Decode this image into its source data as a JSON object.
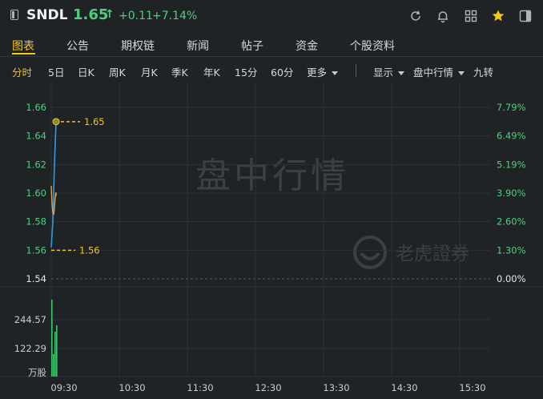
{
  "header": {
    "symbol": "SNDL",
    "price": "1.65",
    "price_arrow": "↑",
    "change": "+0.11",
    "change_pct": "+7.14%"
  },
  "tabs": [
    "图表",
    "公告",
    "期权链",
    "新闻",
    "帖子",
    "资金",
    "个股资料"
  ],
  "active_tab": "图表",
  "periods": [
    "分时",
    "5日",
    "日K",
    "周K",
    "月K",
    "季K",
    "年K",
    "15分",
    "60分",
    "更多"
  ],
  "active_period": "分时",
  "toolbar_right": [
    "显示",
    "盘中行情",
    "九转"
  ],
  "chart": {
    "watermark": "盘中行情",
    "brand": "老虎證券",
    "left_ticks": [
      "1.66",
      "1.64",
      "1.62",
      "1.60",
      "1.58",
      "1.56",
      "1.54"
    ],
    "right_ticks": [
      "7.79%",
      "6.49%",
      "5.19%",
      "3.90%",
      "2.60%",
      "1.30%",
      "0.00%"
    ],
    "high_label": "1.65",
    "low_label": "1.56",
    "volume_ticks": [
      "244.57",
      "122.29"
    ],
    "volume_unit": "万股",
    "time_labels": [
      "09:30",
      "10:30",
      "11:30",
      "12:30",
      "13:30",
      "14:30",
      "15:30"
    ]
  },
  "colors": {
    "up": "#4cd07d",
    "accent": "#f5c518",
    "price_line": "#2e9be6",
    "avg_line": "#e8a050",
    "volume": "#3fc46c"
  },
  "chart_data": {
    "type": "line",
    "x_axis": [
      "09:30",
      "10:30",
      "11:30",
      "12:30",
      "13:30",
      "14:30",
      "15:30"
    ],
    "y_axis_left": [
      1.54,
      1.56,
      1.58,
      1.6,
      1.62,
      1.64,
      1.66
    ],
    "y_axis_right_pct": [
      "0.00%",
      "1.30%",
      "2.60%",
      "3.90%",
      "5.19%",
      "6.49%",
      "7.79%"
    ],
    "ylim": [
      1.54,
      1.67
    ],
    "series": [],
    "markers": [
      {
        "label": "1.65",
        "value": 1.65
      },
      {
        "label": "1.56",
        "value": 1.56
      }
    ],
    "volume_axis": [
      "122.29",
      "244.57"
    ],
    "volume_unit": "万股"
  }
}
